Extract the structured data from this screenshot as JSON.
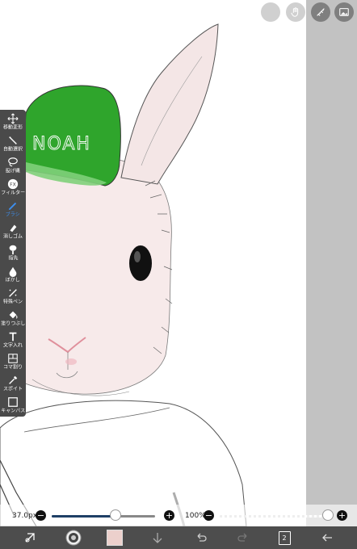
{
  "toolbar": {
    "tools": [
      {
        "label": "移動変形",
        "icon": "move-icon"
      },
      {
        "label": "自動選択",
        "icon": "magic-wand-icon"
      },
      {
        "label": "投げ縄",
        "icon": "lasso-icon"
      },
      {
        "label": "フィルター",
        "icon": "fx-icon"
      },
      {
        "label": "ブラシ",
        "icon": "brush-icon"
      },
      {
        "label": "消しゴム",
        "icon": "eraser-icon"
      },
      {
        "label": "指先",
        "icon": "smudge-icon"
      },
      {
        "label": "ぼかし",
        "icon": "blur-icon"
      },
      {
        "label": "特殊ペン",
        "icon": "special-pen-icon"
      },
      {
        "label": "塗りつぶし",
        "icon": "bucket-icon"
      },
      {
        "label": "文字入れ",
        "icon": "text-icon"
      },
      {
        "label": "コマ割り",
        "icon": "frame-divider-icon"
      },
      {
        "label": "スポイト",
        "icon": "eyedropper-icon"
      },
      {
        "label": "キャンバス",
        "icon": "canvas-icon"
      }
    ],
    "fx_text": "FX",
    "active_tool": "ブラシ",
    "active_color": "#3d8ff0"
  },
  "top_buttons": [
    "circle-blank-icon",
    "hand-icon",
    "ruler-icon",
    "reference-image-icon"
  ],
  "canvas": {
    "cap_text": "NOAH",
    "cap_color": "#2fa52c",
    "skin_color": "#f7eaea"
  },
  "slider_bar": {
    "brush_size_label": "37.0px",
    "brush_size_fraction": 0.62,
    "opacity_label": "100%",
    "opacity_fraction": 1.0
  },
  "bottom_bar": {
    "current_color": "#ecd0cc",
    "layer_count": "2",
    "items": [
      "flip-icon",
      "color-wheel-icon",
      "color-swatch",
      "down-arrow-icon",
      "undo-icon",
      "redo-icon",
      "layers-icon",
      "back-arrow-icon"
    ]
  }
}
